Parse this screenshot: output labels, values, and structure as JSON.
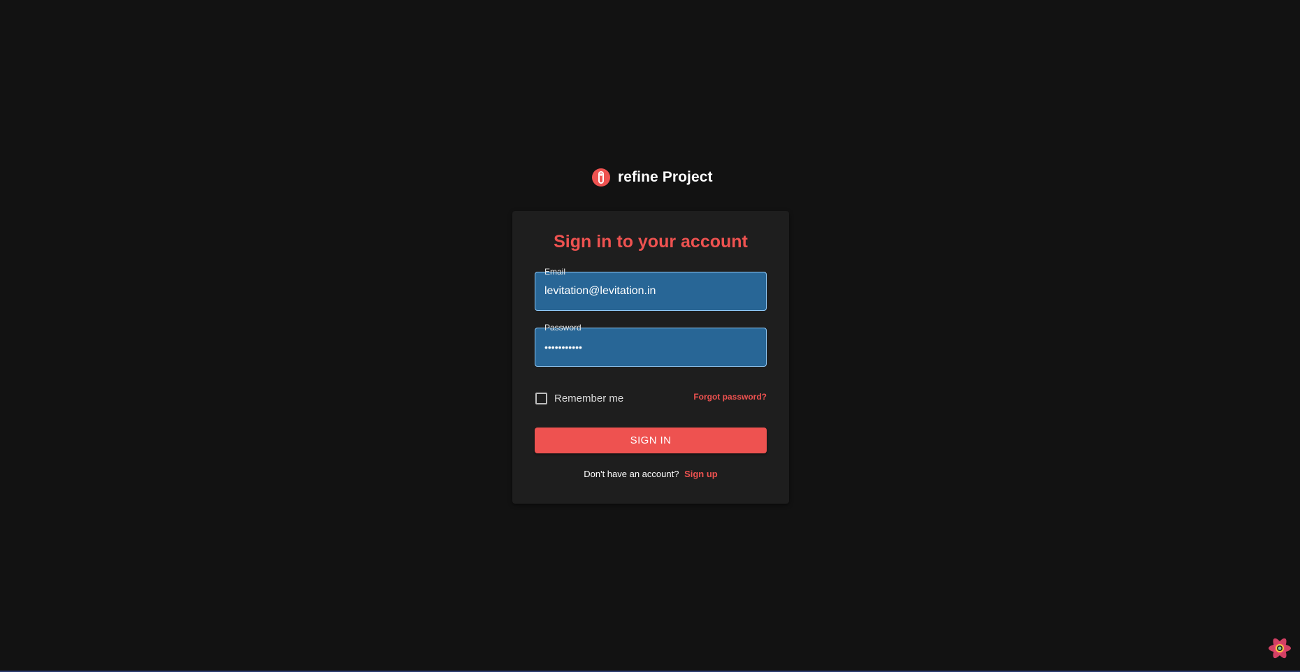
{
  "brand": {
    "title": "refine Project",
    "logo_icon": "refine-logo-icon",
    "color": "#ee5250"
  },
  "login": {
    "heading": "Sign in to your account",
    "email": {
      "label": "Email",
      "value": "levitation@levitation.in"
    },
    "password": {
      "label": "Password",
      "value": "•••••••••••"
    },
    "remember_me": {
      "label": "Remember me",
      "checked": false
    },
    "forgot_password": "Forgot password?",
    "submit_label": "SIGN IN",
    "signup_prompt": "Don't have an account?",
    "signup_link": "Sign up"
  },
  "devtools": {
    "icon": "react-devtools-icon"
  },
  "colors": {
    "background": "#121212",
    "card": "#1e1e1e",
    "accent": "#ee5250",
    "input_fill": "#286696",
    "input_border": "#90caf9"
  }
}
